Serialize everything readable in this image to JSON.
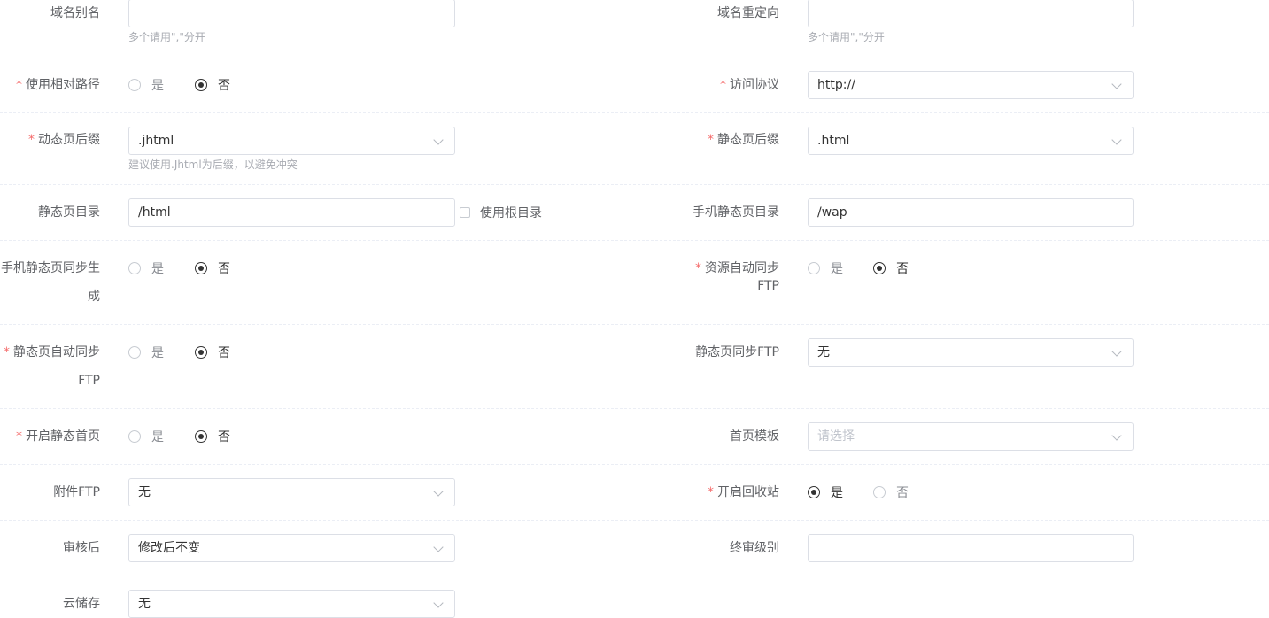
{
  "rows": [
    {
      "left": {
        "label": "域名别名",
        "value": "",
        "tip": "多个请用\",\"分开"
      },
      "right": {
        "label": "域名重定向",
        "value": "",
        "tip": "多个请用\",\"分开"
      }
    },
    {
      "left": {
        "label": "使用相对路径",
        "options": [
          "是",
          "否"
        ],
        "selected": "否"
      },
      "right": {
        "label": "访问协议",
        "value": "http://"
      }
    },
    {
      "left": {
        "label": "动态页后缀",
        "value": ".jhtml",
        "tip": "建议使用.Jhtml为后缀，以避免冲突"
      },
      "right": {
        "label": "静态页后缀",
        "value": ".html"
      }
    },
    {
      "left": {
        "label": "静态页目录",
        "value": "/html",
        "checkbox_label": "使用根目录"
      },
      "right": {
        "label": "手机静态页目录",
        "value": "/wap"
      }
    },
    {
      "left": {
        "label_line1": "手机静态页同步生",
        "label_line2": "成",
        "options": [
          "是",
          "否"
        ],
        "selected": "否"
      },
      "right": {
        "label": "资源自动同步FTP",
        "options": [
          "是",
          "否"
        ],
        "selected": "否"
      }
    },
    {
      "left": {
        "label_line1": "静态页自动同步",
        "label_line2": "FTP",
        "options": [
          "是",
          "否"
        ],
        "selected": "否"
      },
      "right": {
        "label": "静态页同步FTP",
        "value": "无"
      }
    },
    {
      "left": {
        "label": "开启静态首页",
        "options": [
          "是",
          "否"
        ],
        "selected": "否"
      },
      "right": {
        "label": "首页模板",
        "placeholder": "请选择"
      }
    },
    {
      "left": {
        "label": "附件FTP",
        "value": "无"
      },
      "right": {
        "label": "开启回收站",
        "options": [
          "是",
          "否"
        ],
        "selected": "是"
      }
    },
    {
      "left": {
        "label": "审核后",
        "value": "修改后不变"
      },
      "right": {
        "label": "终审级别",
        "value": ""
      }
    },
    {
      "left": {
        "label": "云储存",
        "value": "无"
      }
    }
  ],
  "colors": {
    "required": "#f56c6c",
    "border": "#dcdfe6",
    "text": "#333333",
    "label": "#606266"
  }
}
